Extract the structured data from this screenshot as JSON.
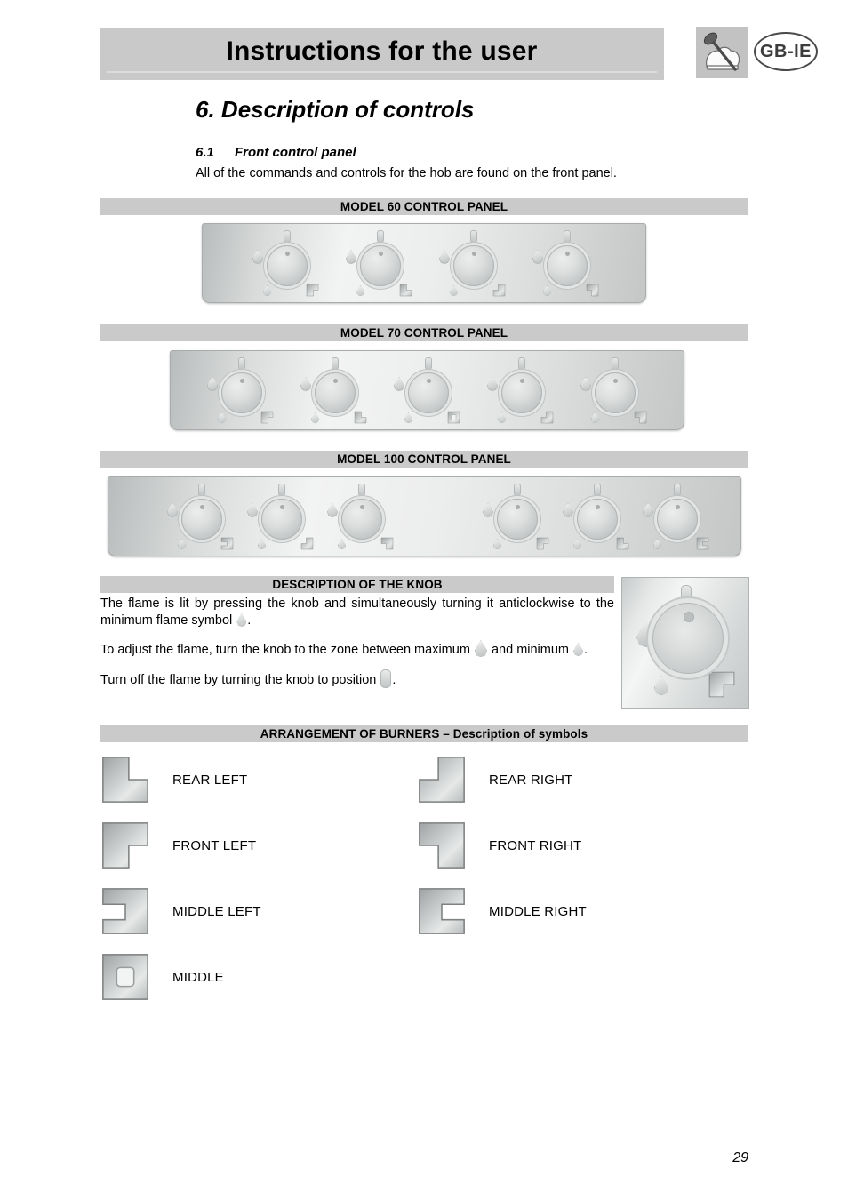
{
  "header": {
    "title": "Instructions for the user",
    "language_badge": "GB-IE",
    "brand_icon": "chef-hat-spoon-icon"
  },
  "headings": {
    "chapter_number": "6.",
    "chapter_title": "Description of controls",
    "section_number": "6.1",
    "section_title": "Front control panel",
    "section_intro": "All of the commands and controls for the hob are found on the front panel."
  },
  "panels": [
    {
      "bar_label": "MODEL 60 CONTROL PANEL",
      "knobs": [
        {
          "burner": "front-left"
        },
        {
          "burner": "rear-left"
        },
        {
          "burner": "rear-right"
        },
        {
          "burner": "front-right"
        }
      ]
    },
    {
      "bar_label": "MODEL 70 CONTROL PANEL",
      "knobs": [
        {
          "burner": "front-left"
        },
        {
          "burner": "rear-left"
        },
        {
          "burner": "middle"
        },
        {
          "burner": "rear-right"
        },
        {
          "burner": "front-right"
        }
      ]
    },
    {
      "bar_label": "MODEL 100 CONTROL PANEL",
      "knobs": [
        {
          "burner": "middle-left"
        },
        {
          "burner": "rear-right"
        },
        {
          "burner": "front-right"
        },
        {
          "burner": "front-left"
        },
        {
          "burner": "rear-left"
        },
        {
          "burner": "middle-right"
        }
      ]
    }
  ],
  "knob_section": {
    "bar_label": "DESCRIPTION OF THE KNOB",
    "para1_a": "The flame is lit by pressing the knob and simultaneously turning it anticlockwise to the minimum flame symbol",
    "para1_b": ".",
    "para2_a": "To adjust the flame, turn the knob to the zone between maximum",
    "para2_b": "and minimum",
    "para2_c": ".",
    "para3_a": "Turn off the flame by turning the knob to position",
    "para3_b": ".",
    "diagram_name": "knob-detail-diagram"
  },
  "burners_section": {
    "bar_label": "ARRANGEMENT OF BURNERS – Description of symbols",
    "items": [
      {
        "symbol": "rear-left",
        "label": "REAR LEFT"
      },
      {
        "symbol": "rear-right",
        "label": "REAR RIGHT"
      },
      {
        "symbol": "front-left",
        "label": "FRONT LEFT"
      },
      {
        "symbol": "front-right",
        "label": "FRONT RIGHT"
      },
      {
        "symbol": "middle-left",
        "label": "MIDDLE LEFT"
      },
      {
        "symbol": "middle-right",
        "label": "MIDDLE RIGHT"
      },
      {
        "symbol": "middle",
        "label": "MIDDLE"
      }
    ]
  },
  "footer": {
    "page_number": "29"
  },
  "colors": {
    "bar_gray": "#cacaca",
    "title_gray": "#c9c9c9",
    "metal_light": "#f2f3f3",
    "metal_dark": "#b9bcbc",
    "text": "#000000"
  }
}
